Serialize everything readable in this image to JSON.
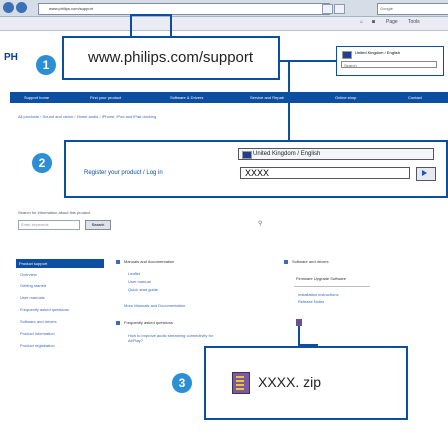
{
  "browser": {
    "url": "www.philips.com/support",
    "search_placeholder": "Google",
    "toolbar": {
      "page_label": "Page",
      "tools_label": "Tools"
    }
  },
  "page": {
    "logo": "PH",
    "nav": [
      "Support home",
      "Find your product",
      "Software & Drivers",
      "Service and Repair",
      "Online shop",
      "Contact"
    ],
    "breadcrumb": "All products › Sound and vision › Home audio › iPhone, iPod and iPad docking",
    "search_hint": "Search for information about this product",
    "search_placeholder": "Enter keywords",
    "search_button": "Search",
    "left_nav": {
      "title": "Product support",
      "items": [
        "Overview",
        "Getting started",
        "User manuals",
        "Frequently asked questions",
        "Software and drivers",
        "Product information",
        "Product registration"
      ]
    },
    "manuals": {
      "title": "Manuals and documentation",
      "items": [
        "Leaflet",
        "User manual",
        "Quick start guide"
      ],
      "more": "More Manuals and Documentation"
    },
    "faq": {
      "title": "Frequently asked questions",
      "items": [
        "How to improve audio streaming connectivity for AirPlay?"
      ]
    },
    "software": {
      "title": "Software and drivers",
      "heading": "Firmware Upgrade Software",
      "links": [
        "Installation instructions",
        "Release Notes"
      ]
    }
  },
  "callouts": {
    "c1": {
      "number": "1",
      "text": "www.philips.com/support"
    },
    "c2": {
      "number": "2",
      "register_label": "Register your product / Log in",
      "country": "United Kingdom / English",
      "field_value": "XXXX"
    },
    "c3": {
      "number": "3",
      "filename": "XXXX. zip"
    }
  },
  "mini_region": {
    "country": "United Kingdom / English",
    "search": "Search"
  }
}
